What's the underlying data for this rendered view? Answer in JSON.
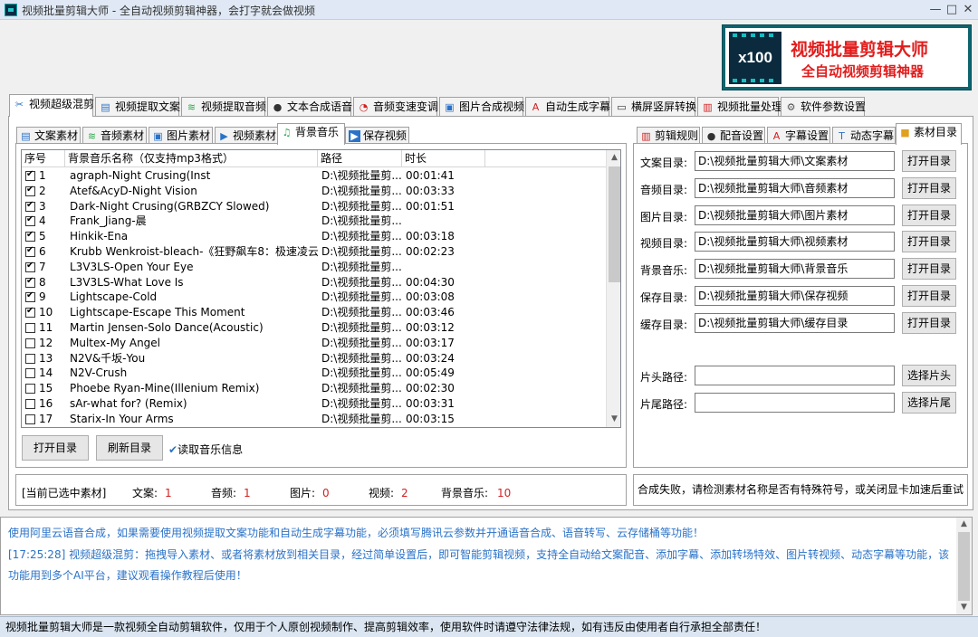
{
  "window": {
    "title": "视频批量剪辑大师 - 全自动视频剪辑神器，会打字就会做视频",
    "controls": [
      "—",
      "□",
      "✕"
    ]
  },
  "banner": {
    "logo_text": "x100",
    "title": "视频批量剪辑大师",
    "subtitle": "全自动视频剪辑神器"
  },
  "main_tabs": [
    {
      "label": "视频超级混剪",
      "icon": "scissors-icon",
      "active": true
    },
    {
      "label": "视频提取文案",
      "icon": "document-icon"
    },
    {
      "label": "视频提取音频",
      "icon": "audio-wave-icon"
    },
    {
      "label": "文本合成语音",
      "icon": "microphone-icon"
    },
    {
      "label": "音频变速变调",
      "icon": "speedometer-icon"
    },
    {
      "label": "图片合成视频",
      "icon": "image-icon"
    },
    {
      "label": "自动生成字幕",
      "icon": "subtitle-icon"
    },
    {
      "label": "横屏竖屏转换",
      "icon": "rotate-screen-icon"
    },
    {
      "label": "视频批量处理",
      "icon": "film-icon"
    },
    {
      "label": "软件参数设置",
      "icon": "gear-icon"
    }
  ],
  "sub_tabs": [
    {
      "label": "文案素材",
      "icon": "document-icon"
    },
    {
      "label": "音频素材",
      "icon": "audio-wave-icon"
    },
    {
      "label": "图片素材",
      "icon": "image-icon"
    },
    {
      "label": "视频素材",
      "icon": "play-icon"
    },
    {
      "label": "背景音乐",
      "icon": "music-note-icon",
      "active": true
    },
    {
      "label": "保存视频",
      "icon": "save-icon"
    }
  ],
  "right_tabs": [
    {
      "label": "剪辑规则",
      "icon": "film-icon"
    },
    {
      "label": "配音设置",
      "icon": "microphone-icon"
    },
    {
      "label": "字幕设置",
      "icon": "subtitle-icon"
    },
    {
      "label": "动态字幕",
      "icon": "text-icon"
    },
    {
      "label": "素材目录",
      "icon": "folder-icon",
      "active": true
    }
  ],
  "table": {
    "headers": [
      "序号",
      "背景音乐名称（仅支持mp3格式）",
      "路径",
      "时长"
    ],
    "rows": [
      {
        "no": "1",
        "checked": true,
        "name": "agraph-Night Crusing(Inst",
        "path": "D:\\视频批量剪...",
        "duration": "00:01:41"
      },
      {
        "no": "2",
        "checked": true,
        "name": "Atef&AcyD-Night Vision",
        "path": "D:\\视频批量剪...",
        "duration": "00:03:33"
      },
      {
        "no": "3",
        "checked": true,
        "name": "Dark-Night Crusing(GRBZCY Slowed)",
        "path": "D:\\视频批量剪...",
        "duration": "00:01:51"
      },
      {
        "no": "4",
        "checked": true,
        "name": "Frank_Jiang-晨",
        "path": "D:\\视频批量剪...",
        "duration": ""
      },
      {
        "no": "5",
        "checked": true,
        "name": "Hinkik-Ena",
        "path": "D:\\视频批量剪...",
        "duration": "00:03:18"
      },
      {
        "no": "6",
        "checked": true,
        "name": "Krubb Wenkroist-bleach-《狂野飙车8：极速凌云...",
        "path": "D:\\视频批量剪...",
        "duration": "00:02:23"
      },
      {
        "no": "7",
        "checked": true,
        "name": "L3V3LS-Open Your Eye",
        "path": "D:\\视频批量剪...",
        "duration": ""
      },
      {
        "no": "8",
        "checked": true,
        "name": "L3V3LS-What Love Is",
        "path": "D:\\视频批量剪...",
        "duration": "00:04:30"
      },
      {
        "no": "9",
        "checked": true,
        "name": "Lightscape-Cold",
        "path": "D:\\视频批量剪...",
        "duration": "00:03:08"
      },
      {
        "no": "10",
        "checked": true,
        "name": "Lightscape-Escape This Moment",
        "path": "D:\\视频批量剪...",
        "duration": "00:03:46"
      },
      {
        "no": "11",
        "checked": false,
        "name": "Martin Jensen-Solo Dance(Acoustic)",
        "path": "D:\\视频批量剪...",
        "duration": "00:03:12"
      },
      {
        "no": "12",
        "checked": false,
        "name": "Multex-My Angel",
        "path": "D:\\视频批量剪...",
        "duration": "00:03:17"
      },
      {
        "no": "13",
        "checked": false,
        "name": "N2V&千坂-You",
        "path": "D:\\视频批量剪...",
        "duration": "00:03:24"
      },
      {
        "no": "14",
        "checked": false,
        "name": "N2V-Crush",
        "path": "D:\\视频批量剪...",
        "duration": "00:05:49"
      },
      {
        "no": "15",
        "checked": false,
        "name": "Phoebe Ryan-Mine(Illenium Remix)",
        "path": "D:\\视频批量剪...",
        "duration": "00:02:30"
      },
      {
        "no": "16",
        "checked": false,
        "name": "sAr-what for? (Remix)",
        "path": "D:\\视频批量剪...",
        "duration": "00:03:31"
      },
      {
        "no": "17",
        "checked": false,
        "name": "Starix-In Your Arms",
        "path": "D:\\视频批量剪...",
        "duration": "00:03:15"
      }
    ]
  },
  "left_buttons": {
    "open_dir": "打开目录",
    "refresh_dir": "刷新目录",
    "read_music_info": "读取音乐信息"
  },
  "summary": {
    "title": "[当前已选中素材]",
    "items": [
      {
        "label": "文案:",
        "value": "1"
      },
      {
        "label": "音频:",
        "value": "1"
      },
      {
        "label": "图片:",
        "value": "0"
      },
      {
        "label": "视频:",
        "value": "2"
      },
      {
        "label": "背景音乐:",
        "value": "10"
      }
    ]
  },
  "directories": [
    {
      "label": "文案目录:",
      "value": "D:\\视频批量剪辑大师\\文案素材",
      "button": "打开目录"
    },
    {
      "label": "音频目录:",
      "value": "D:\\视频批量剪辑大师\\音频素材",
      "button": "打开目录"
    },
    {
      "label": "图片目录:",
      "value": "D:\\视频批量剪辑大师\\图片素材",
      "button": "打开目录"
    },
    {
      "label": "视频目录:",
      "value": "D:\\视频批量剪辑大师\\视频素材",
      "button": "打开目录"
    },
    {
      "label": "背景音乐:",
      "value": "D:\\视频批量剪辑大师\\背景音乐",
      "button": "打开目录"
    },
    {
      "label": "保存目录:",
      "value": "D:\\视频批量剪辑大师\\保存视频",
      "button": "打开目录"
    },
    {
      "label": "缓存目录:",
      "value": "D:\\视频批量剪辑大师\\缓存目录",
      "button": "打开目录"
    }
  ],
  "clips": [
    {
      "label": "片头路径:",
      "value": "",
      "button": "选择片头"
    },
    {
      "label": "片尾路径:",
      "value": "",
      "button": "选择片尾"
    }
  ],
  "error_message": "合成失败，请检测素材名称是否有特殊符号，或关闭显卡加速后重试",
  "log": {
    "lines": [
      "使用阿里云语音合成，如果需要使用视频提取文案功能和自动生成字幕功能，必须填写腾讯云参数并开通语音合成、语音转写、云存储桶等功能！",
      "[17:25:28] 视频超级混剪：拖拽导入素材、或者将素材放到相关目录，经过简单设置后，即可智能剪辑视频，支持全自动给文案配音、添加字幕、添加转场特效、图片转视频、动态字幕等功能，该",
      "功能用到多个AI平台，建议观看操作教程后使用！"
    ]
  },
  "status_bar": "视频批量剪辑大师是一款视频全自动剪辑软件，仅用于个人原创视频制作、提高剪辑效率，使用软件时请遵守法律法规，如有违反由使用者自行承担全部责任！",
  "colors": {
    "accent_red": "#e21c1c",
    "log_blue": "#2a72c8",
    "banner_teal": "#0e6570"
  }
}
